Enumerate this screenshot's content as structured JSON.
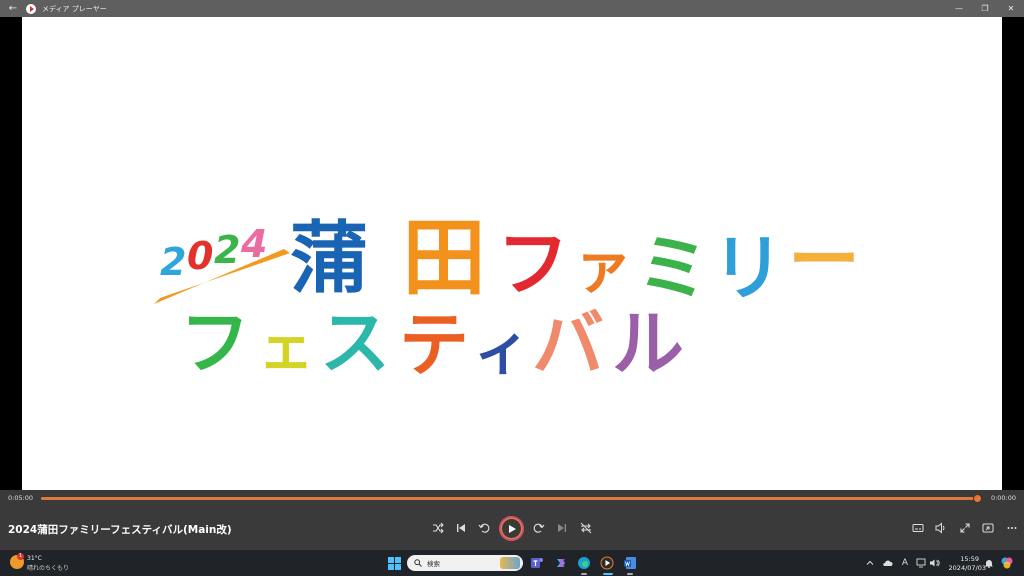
{
  "window": {
    "title": "メディア プレーヤー",
    "back_glyph": "←",
    "minimize_glyph": "—",
    "restore_glyph": "❐",
    "close_glyph": "✕"
  },
  "video": {
    "logo": {
      "year": "2024",
      "line1_kanji": [
        "蒲",
        "田"
      ],
      "line1_kana": [
        "フ",
        "ァ",
        "ミ",
        "リ",
        "ー"
      ],
      "line2_kana": [
        "フ",
        "ェ",
        "ス",
        "テ",
        "ィ",
        "バ",
        "ル"
      ],
      "colors": {
        "year": [
          "#2ea6dc",
          "#e4312b",
          "#3bb54a",
          "#ea6da2"
        ],
        "kanji": [
          "#1a64b4",
          "#f2911b"
        ],
        "line1": [
          "#e3282f",
          "#ee7a22",
          "#3bb34a",
          "#2f9fd9",
          "#f3b03b"
        ],
        "line2": [
          "#35b64a",
          "#d4d425",
          "#2bb7a9",
          "#eb5f22",
          "#2c4fa3",
          "#f08a6c",
          "#9b5ea8"
        ],
        "swoosh": "#f39a1e"
      }
    }
  },
  "player": {
    "current_time": "0:05:00",
    "remaining_time": "0:00:00",
    "progress": 1.0,
    "media_title": "2024蒲田ファミリーフェスティバル(Main改)",
    "accent": "#e07a3c"
  },
  "taskbar": {
    "weather": {
      "badge": "1",
      "temp": "31°C",
      "desc": "晴れのちくもり"
    },
    "search_placeholder": "検索",
    "tray_font_glyph": "A",
    "clock": {
      "time": "15:59",
      "date": "2024/07/03"
    }
  }
}
